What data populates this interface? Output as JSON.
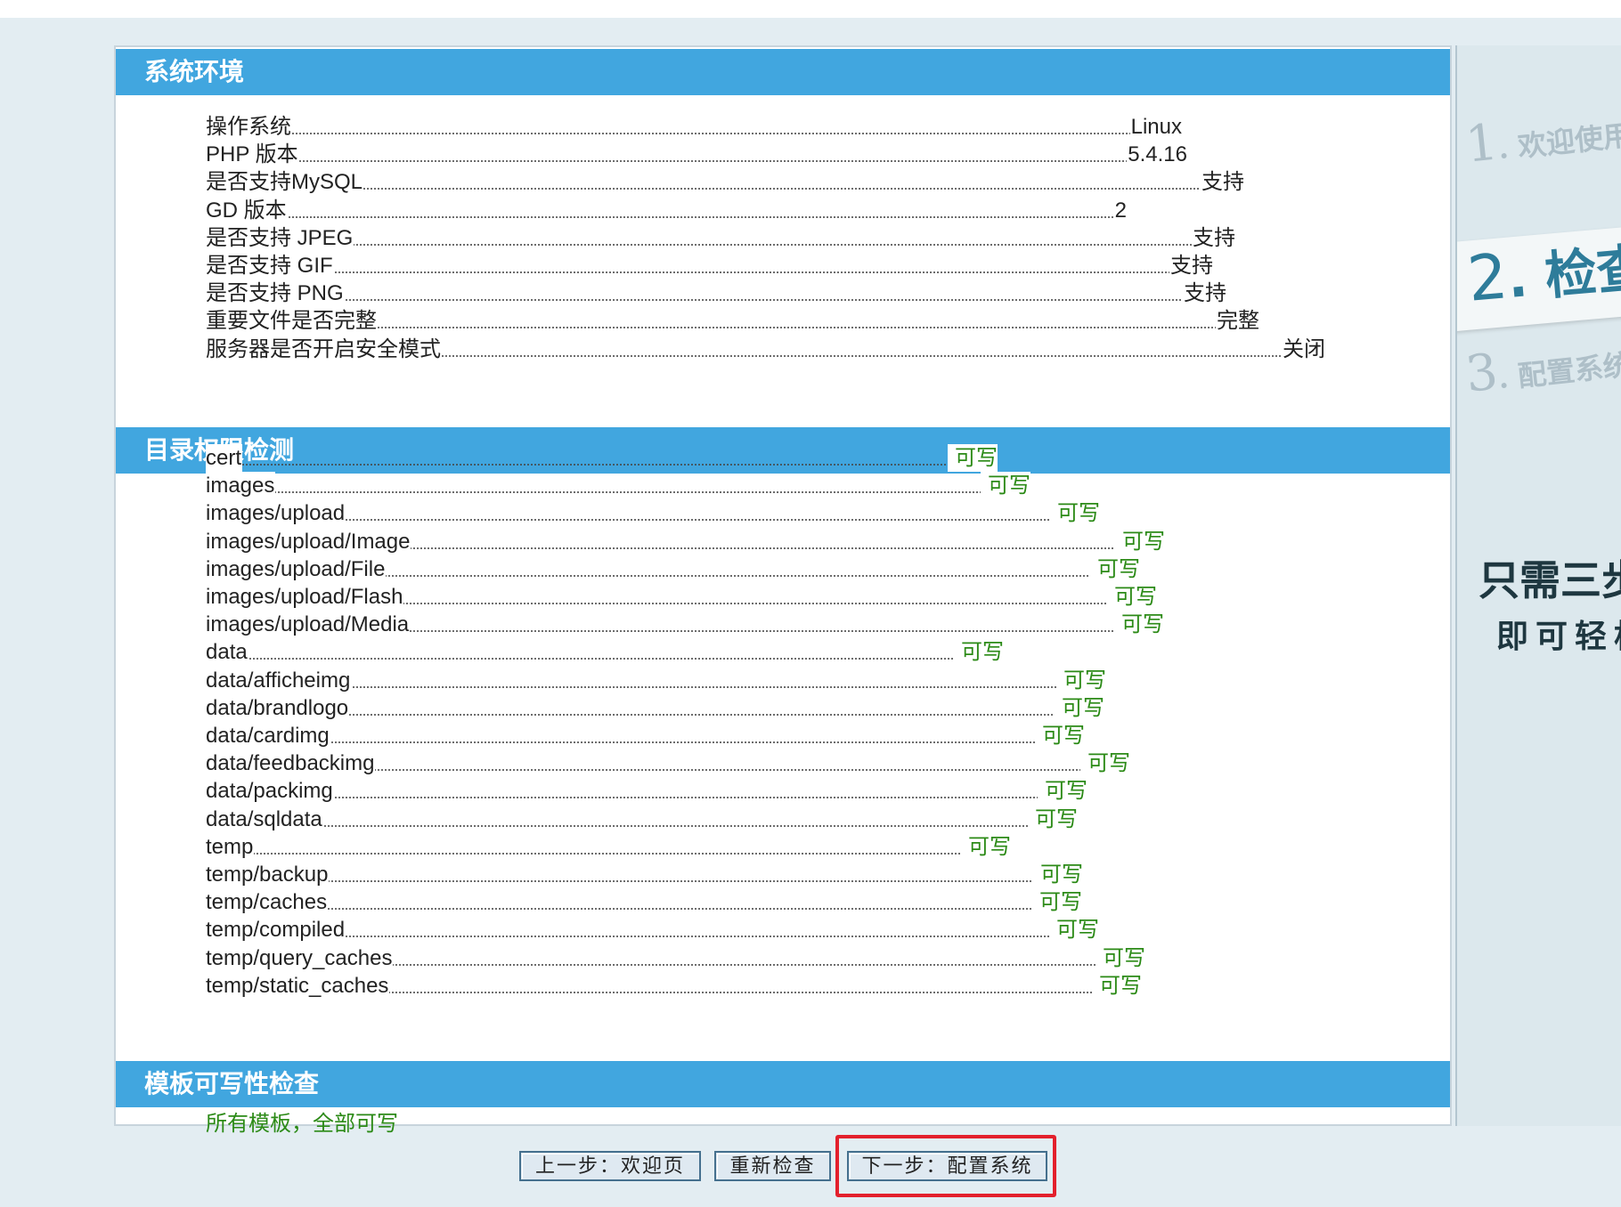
{
  "sections": {
    "system": {
      "title": "系统环境",
      "rows": [
        {
          "label": "操作系统",
          "value": "Linux"
        },
        {
          "label": "PHP 版本",
          "value": "5.4.16"
        },
        {
          "label": "是否支持MySQL",
          "value": "支持"
        },
        {
          "label": "GD 版本",
          "value": "2"
        },
        {
          "label": "是否支持 JPEG",
          "value": "支持"
        },
        {
          "label": "是否支持 GIF",
          "value": "支持"
        },
        {
          "label": "是否支持 PNG",
          "value": "支持"
        },
        {
          "label": "重要文件是否完整",
          "value": "完整"
        },
        {
          "label": "服务器是否开启安全模式",
          "value": "关闭"
        }
      ]
    },
    "dirs": {
      "title": "目录权限检测",
      "rows": [
        {
          "label": "cert",
          "value": "可写"
        },
        {
          "label": "images",
          "value": "可写"
        },
        {
          "label": "images/upload",
          "value": "可写"
        },
        {
          "label": "images/upload/Image",
          "value": "可写"
        },
        {
          "label": "images/upload/File",
          "value": "可写"
        },
        {
          "label": "images/upload/Flash",
          "value": "可写"
        },
        {
          "label": "images/upload/Media",
          "value": "可写"
        },
        {
          "label": "data",
          "value": "可写"
        },
        {
          "label": "data/afficheimg",
          "value": "可写"
        },
        {
          "label": "data/brandlogo",
          "value": "可写"
        },
        {
          "label": "data/cardimg",
          "value": "可写"
        },
        {
          "label": "data/feedbackimg",
          "value": "可写"
        },
        {
          "label": "data/packimg",
          "value": "可写"
        },
        {
          "label": "data/sqldata",
          "value": "可写"
        },
        {
          "label": "temp",
          "value": "可写"
        },
        {
          "label": "temp/backup",
          "value": "可写"
        },
        {
          "label": "temp/caches",
          "value": "可写"
        },
        {
          "label": "temp/compiled",
          "value": "可写"
        },
        {
          "label": "temp/query_caches",
          "value": "可写"
        },
        {
          "label": "temp/static_caches",
          "value": "可写"
        }
      ]
    },
    "templates": {
      "title": "模板可写性检查",
      "message": "所有模板，全部可写"
    }
  },
  "sidebar": {
    "step1": {
      "num": "1",
      "label": ". 欢迎使用"
    },
    "step2": {
      "num": "2",
      "label": ". 检查"
    },
    "step3": {
      "num": "3",
      "label": ". 配置系统"
    },
    "slogan_line1": "只需三步",
    "slogan_line2": "即可轻松"
  },
  "buttons": {
    "prev": "上一步：欢迎页",
    "recheck": "重新检查",
    "next": "下一步：配置系统"
  },
  "colors": {
    "section_header": "#41a6df",
    "ok_text": "#2b8a16",
    "highlight_border": "#e3202c"
  }
}
